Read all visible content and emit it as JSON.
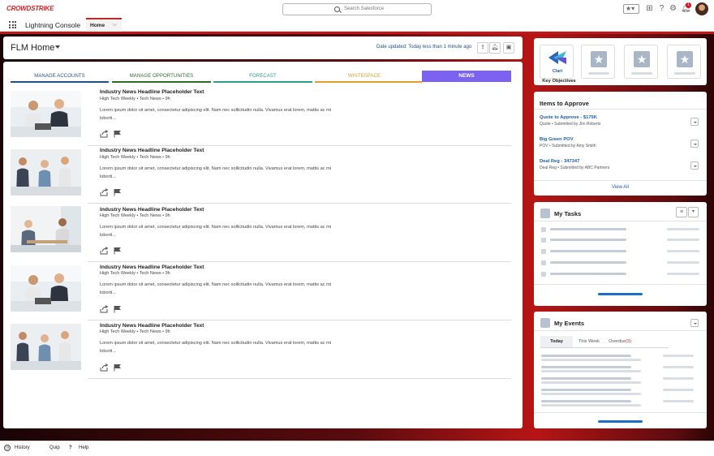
{
  "global_header": {
    "logo_text": "CROWDSTRIKE",
    "search_placeholder": "Search Salesforce",
    "notification_count": "1",
    "accent_color": "#e01e26"
  },
  "app_bar": {
    "app_name": "Lightning Console",
    "tabs": [
      {
        "label": "Home",
        "active": true
      }
    ]
  },
  "page_header": {
    "title": "FLM Home",
    "date_updated": "Date updated: Today less than 1 minute ago"
  },
  "tabs": [
    {
      "label": "MANAGE ACCOUNTS",
      "color": "#1f4e8c"
    },
    {
      "label": "MANAGE OPPORTUNITIES",
      "color": "#2e6b2e"
    },
    {
      "label": "FORECAST",
      "color": "#2a9d8f"
    },
    {
      "label": "WHITESPACE",
      "color": "#e0a030"
    },
    {
      "label": "NEWS",
      "color": "#7b62f0",
      "active": true
    }
  ],
  "news": [
    {
      "title": "Industry News Headline Placeholder Text",
      "source": "High Tech Weekly • Tech News • 9h",
      "body": "Lorem ipsum dolor sit amet, consectetur adipiscing elit. Nam nec sollicitudin nulla. Vivamus erat lorem, mattis ac mi loborti..."
    },
    {
      "title": "Industry News Headline Placeholder Text",
      "source": "High Tech Weekly • Tech News • 9h",
      "body": "Lorem ipsum dolor sit amet, consectetur adipiscing elit. Nam nec sollicitudin nulla. Vivamus erat lorem, mattis ac mi loborti..."
    },
    {
      "title": "Industry News Headline Placeholder Text",
      "source": "High Tech Weekly • Tech News • 9h",
      "body": "Lorem ipsum dolor sit amet, consectetur adipiscing elit. Nam nec sollicitudin nulla. Vivamus erat lorem, mattis ac mi loborti..."
    },
    {
      "title": "Industry News Headline Placeholder Text",
      "source": "High Tech Weekly • Tech News • 9h",
      "body": "Lorem ipsum dolor sit amet, consectetur adipiscing elit. Nam nec sollicitudin nulla. Vivamus erat lorem, mattis ac mi loborti..."
    },
    {
      "title": "Industry News Headline Placeholder Text",
      "source": "High Tech Weekly • Tech News • 9h",
      "body": "Lorem ipsum dolor sit amet, consectetur adipiscing elit. Nam nec sollicitudin nulla. Vivamus erat lorem, mattis ac mi loborti..."
    }
  ],
  "key_objectives": {
    "app_name": "Clari",
    "label": "Key Objectives"
  },
  "approvals": {
    "title": "Items to Approve",
    "items": [
      {
        "name": "Quote to Approve - $175K",
        "meta": "Quote • Submitted by Jim Roberts"
      },
      {
        "name": "Big Green POV",
        "meta": "POV • Submitted by Amy Smith"
      },
      {
        "name": "Deal Reg - 347347",
        "meta": "Deal Reg • Submitted by ABC Partners"
      }
    ],
    "view_all": "View All"
  },
  "tasks": {
    "title": "My Tasks"
  },
  "events": {
    "title": "My Events",
    "tabs": [
      "Today",
      "This Week",
      "Overdue"
    ],
    "overdue_count": "(3)"
  },
  "footer": {
    "items": [
      "History",
      "Quip",
      "Help"
    ]
  }
}
